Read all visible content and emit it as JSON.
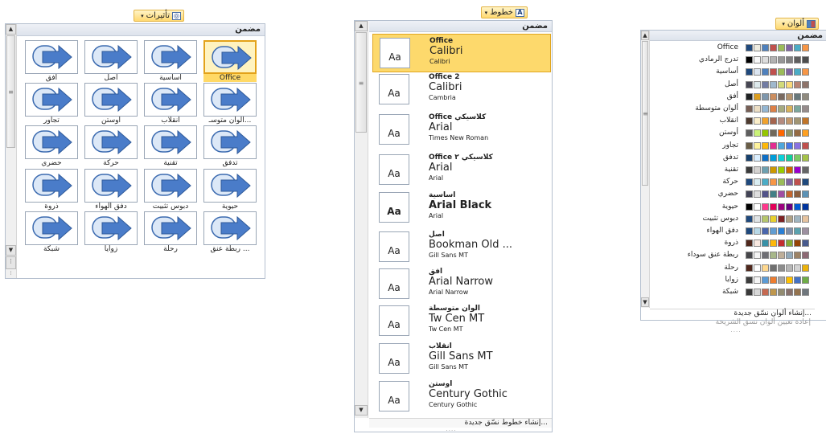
{
  "effects": {
    "button_label": "تأثيرات",
    "header": "مضمن",
    "items": [
      {
        "label": "Office",
        "selected": true
      },
      {
        "label": "أساسية"
      },
      {
        "label": "أصل"
      },
      {
        "label": "أفق"
      },
      {
        "label": "ألوان متوسـ..."
      },
      {
        "label": "انقلاب"
      },
      {
        "label": "أوستن"
      },
      {
        "label": "تجاور"
      },
      {
        "label": "تدفق"
      },
      {
        "label": "تقنية"
      },
      {
        "label": "حركة"
      },
      {
        "label": "حضري"
      },
      {
        "label": "حيوية"
      },
      {
        "label": "دبوس تثبيت"
      },
      {
        "label": "دفق الهواء"
      },
      {
        "label": "ذروة"
      },
      {
        "label": "ربطة عنق ..."
      },
      {
        "label": "رحلة"
      },
      {
        "label": "زوايا"
      },
      {
        "label": "شبكة"
      }
    ]
  },
  "fonts": {
    "button_label": "خطوط",
    "header": "مضمن",
    "items": [
      {
        "name": "Office",
        "heading": "Calibri",
        "body": "Calibri",
        "sample": "Aa",
        "selected": true
      },
      {
        "name": "Office 2",
        "heading": "Calibri",
        "body": "Cambria",
        "sample": "Aa"
      },
      {
        "name": "Office كلاسيكي",
        "heading": "Arial",
        "body": "Times New Roman",
        "sample": "Aa"
      },
      {
        "name": "Office كلاسيكي ٢",
        "heading": "Arial",
        "body": "Arial",
        "sample": "Aa"
      },
      {
        "name": "أساسية",
        "heading": "Arial Black",
        "body": "Arial",
        "sample": "Aa",
        "bold": true
      },
      {
        "name": "أصل",
        "heading": "Bookman Old ...",
        "body": "Gill Sans MT",
        "sample": "Aa"
      },
      {
        "name": "أفق",
        "heading": "Arial Narrow",
        "body": "Arial Narrow",
        "sample": "Aa"
      },
      {
        "name": "ألوان متوسطة",
        "heading": "Tw Cen MT",
        "body": "Tw Cen MT",
        "sample": "Aa"
      },
      {
        "name": "انقلاب",
        "heading": "Gill Sans MT",
        "body": "Gill Sans MT",
        "sample": "Aa"
      },
      {
        "name": "أوستن",
        "heading": "Century Gothic",
        "body": "Century Gothic",
        "sample": "Aa"
      }
    ],
    "footer_create": "إنشاء خطوط نسّق جديدة..."
  },
  "colors": {
    "button_label": "ألوان",
    "header": "مضمن",
    "items": [
      {
        "label": "Office",
        "sw": [
          "#1f497d",
          "#eeece1",
          "#4f81bd",
          "#c0504d",
          "#9bbb59",
          "#8064a2",
          "#4bacc6",
          "#f79646"
        ]
      },
      {
        "label": "تدرج الرمادي",
        "sw": [
          "#000000",
          "#f8f8f8",
          "#dddddd",
          "#b2b2b2",
          "#969696",
          "#808080",
          "#5f5f5f",
          "#4d4d4d"
        ]
      },
      {
        "label": "أساسية",
        "sw": [
          "#1f497d",
          "#dbe5f1",
          "#4f81bd",
          "#c0504d",
          "#9bbb59",
          "#8064a2",
          "#4bacc6",
          "#f79646"
        ]
      },
      {
        "label": "أصل",
        "sw": [
          "#464653",
          "#dde9ec",
          "#727ca3",
          "#9fb8cd",
          "#d2da7a",
          "#fada7a",
          "#b88472",
          "#8e736a"
        ]
      },
      {
        "label": "أفق",
        "sw": [
          "#1f2123",
          "#dc9e1f",
          "#7e97ad",
          "#cc8e60",
          "#7a6a60",
          "#b4936d",
          "#67787b",
          "#8f8a7e"
        ]
      },
      {
        "label": "ألوان متوسطة",
        "sw": [
          "#775f55",
          "#ebddc3",
          "#94b6d2",
          "#dd8047",
          "#a5ab81",
          "#d8b25c",
          "#7ba79d",
          "#968c8c"
        ]
      },
      {
        "label": "انقلاب",
        "sw": [
          "#4e3b30",
          "#fbeec9",
          "#f0a22e",
          "#a5644e",
          "#b58b80",
          "#c3986d",
          "#a19574",
          "#c17529"
        ]
      },
      {
        "label": "أوستن",
        "sw": [
          "#5e5e5e",
          "#caf278",
          "#94c600",
          "#71685a",
          "#ff6700",
          "#909465",
          "#956b43",
          "#fea022"
        ]
      },
      {
        "label": "تجاور",
        "sw": [
          "#695d46",
          "#fff39d",
          "#feb80a",
          "#e32d91",
          "#4ea6dc",
          "#4775e7",
          "#8971e1",
          "#c0504d"
        ]
      },
      {
        "label": "تدفق",
        "sw": [
          "#17406d",
          "#dbefff",
          "#0f6fc6",
          "#009dd9",
          "#0bd0d9",
          "#10cf9b",
          "#7cca62",
          "#a5c249"
        ]
      },
      {
        "label": "تقنية",
        "sw": [
          "#3b3b3b",
          "#d4d2d0",
          "#6ea0b0",
          "#cc9900",
          "#99cc00",
          "#cc6600",
          "#9900cc",
          "#666666"
        ]
      },
      {
        "label": "حركة",
        "sw": [
          "#1f497d",
          "#daeef3",
          "#4bacc6",
          "#f79646",
          "#9bbb59",
          "#8064a2",
          "#c0504d",
          "#1f497d"
        ]
      },
      {
        "label": "حضري",
        "sw": [
          "#424456",
          "#dedede",
          "#53548a",
          "#438086",
          "#a04da3",
          "#c4652d",
          "#8b5d3d",
          "#5c92b5"
        ]
      },
      {
        "label": "حيوية",
        "sw": [
          "#000000",
          "#ffffff",
          "#ff388c",
          "#e40059",
          "#9c007f",
          "#68007f",
          "#005bd3",
          "#00349e"
        ]
      },
      {
        "label": "دبوس تثبيت",
        "sw": [
          "#1f497d",
          "#dfe3e5",
          "#b6c66d",
          "#e8d12c",
          "#7d2222",
          "#b0a286",
          "#a0b5c0",
          "#e6c39f"
        ]
      },
      {
        "label": "دفق الهواء",
        "sw": [
          "#1f497d",
          "#b7d8e7",
          "#4a66ac",
          "#629dd1",
          "#297fd5",
          "#7f8fa9",
          "#5aa2ae",
          "#9d90a0"
        ]
      },
      {
        "label": "ذروة",
        "sw": [
          "#4f271c",
          "#f8e8e0",
          "#3891a7",
          "#feb80a",
          "#c32d2e",
          "#84aa33",
          "#964305",
          "#475a8d"
        ]
      },
      {
        "label": "ربطة عنق سوداء",
        "sw": [
          "#46464a",
          "#f4f4f4",
          "#6f6f74",
          "#a7b789",
          "#beae98",
          "#92a9b9",
          "#9c8265",
          "#8d6974"
        ]
      },
      {
        "label": "رحلة",
        "sw": [
          "#4f271c",
          "#ffffff",
          "#ffd88e",
          "#6f6f6f",
          "#8c8c8c",
          "#b6b6b6",
          "#d3d3d3",
          "#ebb20b"
        ]
      },
      {
        "label": "زوايا",
        "sw": [
          "#3d3d3d",
          "#f5f5f5",
          "#5b9bd5",
          "#ed7d31",
          "#a5a5a5",
          "#ffc000",
          "#4472c4",
          "#70ad47"
        ]
      },
      {
        "label": "شبكة",
        "sw": [
          "#3a3a3a",
          "#d8d8d8",
          "#c66951",
          "#bf974d",
          "#928b70",
          "#87706b",
          "#94734e",
          "#6f777d"
        ]
      }
    ],
    "footer_create": "إنشاء ألوان نسّق جديدة...",
    "footer_reset": "إعادة تعيين ألوان نسق الشريحة"
  }
}
